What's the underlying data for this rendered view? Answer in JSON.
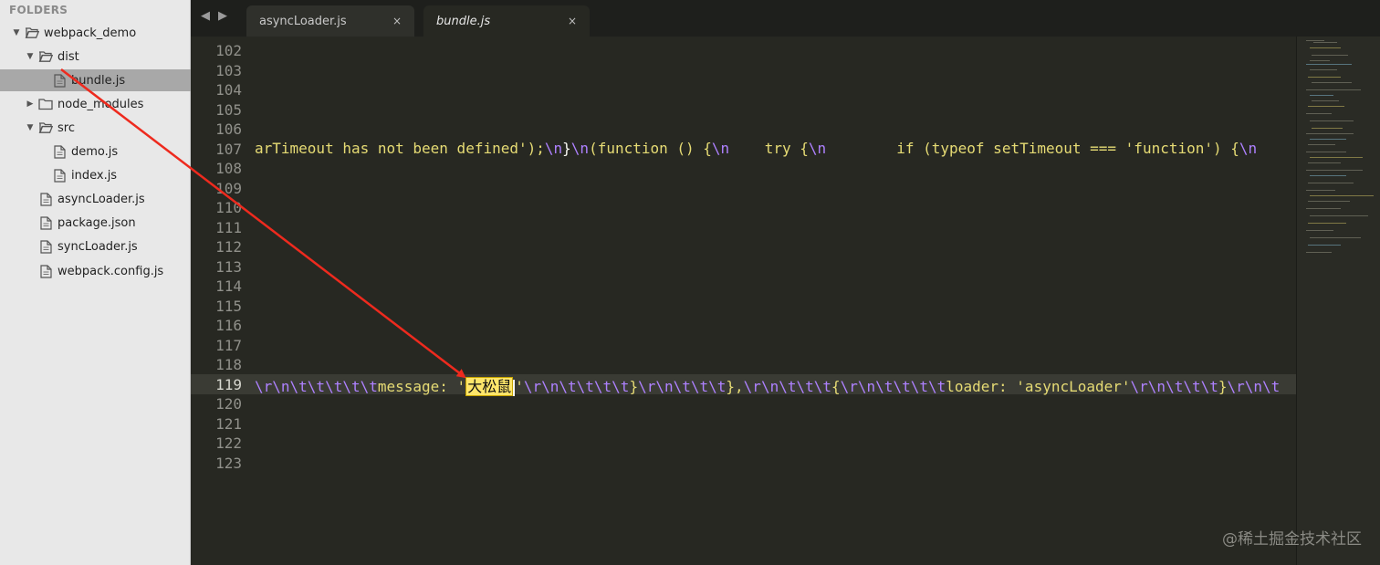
{
  "sidebar": {
    "header": "FOLDERS",
    "items": [
      {
        "label": "webpack_demo",
        "type": "folder-open",
        "depth": 0
      },
      {
        "label": "dist",
        "type": "folder-open",
        "depth": 1
      },
      {
        "label": "bundle.js",
        "type": "file",
        "depth": 2,
        "selected": true
      },
      {
        "label": "node_modules",
        "type": "folder-closed",
        "depth": 1
      },
      {
        "label": "src",
        "type": "folder-open",
        "depth": 1
      },
      {
        "label": "demo.js",
        "type": "file",
        "depth": 2
      },
      {
        "label": "index.js",
        "type": "file",
        "depth": 2
      },
      {
        "label": "asyncLoader.js",
        "type": "file",
        "depth": 1
      },
      {
        "label": "package.json",
        "type": "file",
        "depth": 1
      },
      {
        "label": "syncLoader.js",
        "type": "file",
        "depth": 1
      },
      {
        "label": "webpack.config.js",
        "type": "file",
        "depth": 1
      }
    ]
  },
  "tabs": {
    "nav_back": "◀",
    "nav_forward": "▶",
    "items": [
      {
        "label": "asyncLoader.js",
        "close": "×",
        "active": false
      },
      {
        "label": "bundle.js",
        "close": "×",
        "active": true
      }
    ]
  },
  "editor": {
    "line_numbers": [
      "102",
      "103",
      "104",
      "105",
      "106",
      "107",
      "108",
      "109",
      "110",
      "111",
      "112",
      "113",
      "114",
      "115",
      "116",
      "117",
      "118",
      "119",
      "120",
      "121",
      "122",
      "123"
    ],
    "current_line": "119",
    "line107": {
      "a": "arTimeout has not been defined');",
      "b": "\\n",
      "c": "}",
      "d": "\\n",
      "e": "(function () {",
      "f": "\\n",
      "g": "    try {",
      "h": "\\n",
      "i": "        if (typeof setTimeout === 'function') {",
      "j": "\\n"
    },
    "line119": {
      "a": "\\r\\n\\t\\t\\t\\t\\t",
      "b": "message: '",
      "highlight": "大松鼠",
      "c": "'",
      "d": "\\r\\n\\t\\t\\t\\t",
      "e": "}",
      "f": "\\r\\n\\t\\t\\t",
      "g": "},",
      "h": "\\r\\n\\t\\t\\t",
      "i": "{",
      "j": "\\r\\n\\t\\t\\t\\t",
      "k": "loader: 'asyncLoader'",
      "l": "\\r\\n\\t\\t\\t",
      "m": "}",
      "n": "\\r\\n\\t"
    }
  },
  "watermark": "@稀土掘金技术社区",
  "colors": {
    "editor_bg": "#272822",
    "string": "#e6db74",
    "escape": "#ae81ff",
    "arrow": "#ee2a1e",
    "highlight": "#ffe66a"
  }
}
